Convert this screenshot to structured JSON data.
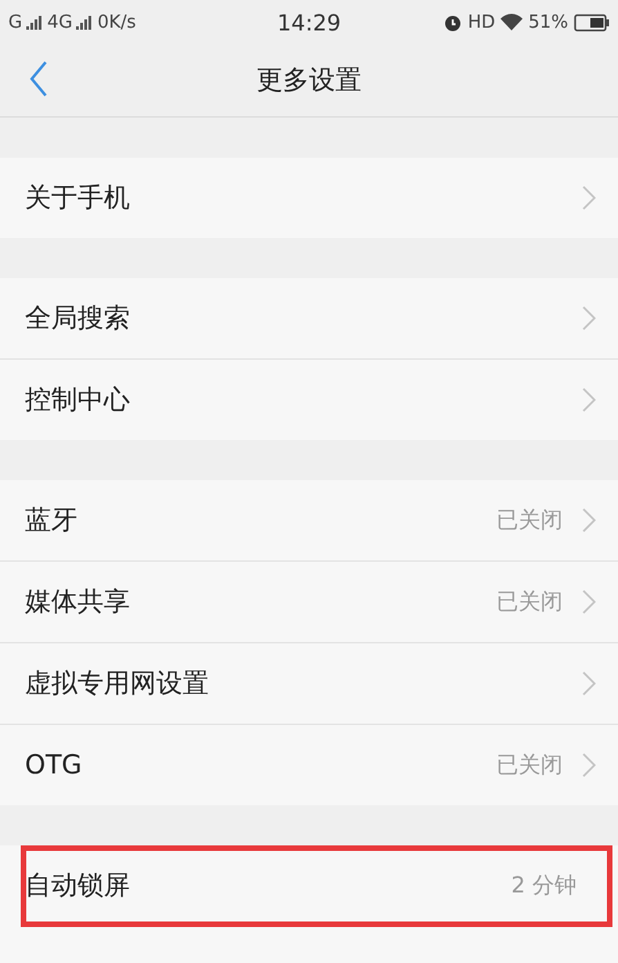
{
  "status_bar": {
    "carrier_1": "G",
    "carrier_2": "4G",
    "speed": "0K/s",
    "time": "14:29",
    "hd": "HD",
    "battery": "51%"
  },
  "header": {
    "title": "更多设置"
  },
  "groups": [
    {
      "items": [
        {
          "label": "关于手机",
          "highlighted": false
        }
      ]
    },
    {
      "items": [
        {
          "label": "全局搜索",
          "highlighted": false
        },
        {
          "label": "控制中心",
          "highlighted": false
        }
      ]
    },
    {
      "items": [
        {
          "label": "蓝牙",
          "value": "已关闭",
          "highlighted": false
        },
        {
          "label": "媒体共享",
          "value": "已关闭",
          "highlighted": false
        },
        {
          "label": "虚拟专用网设置",
          "highlighted": false
        },
        {
          "label": "OTG",
          "value": "已关闭",
          "highlighted": false
        }
      ]
    },
    {
      "items": [
        {
          "label": "自动锁屏",
          "value": "2 分钟",
          "highlighted": true
        },
        {
          "kind": "cut"
        }
      ]
    }
  ]
}
